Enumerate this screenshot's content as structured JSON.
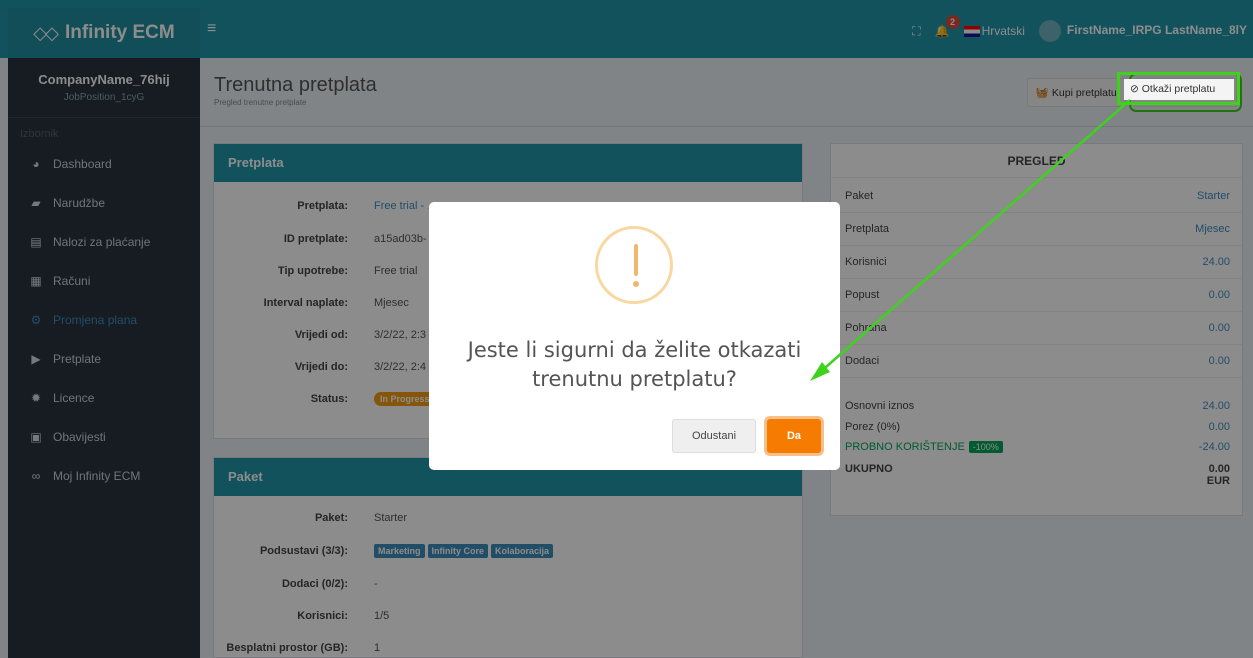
{
  "topbar": {
    "brand": "Infinity ECM",
    "notif_count": "2",
    "language": "Hrvatski",
    "user_name": "FirstName_IRPG LastName_8lY"
  },
  "sidebar": {
    "company": "CompanyName_76hij",
    "position": "JobPosition_1cyG",
    "menu_header": "Izbornik",
    "items": [
      {
        "label": "Dashboard",
        "icon": "dashboard-icon"
      },
      {
        "label": "Narudžbe",
        "icon": "truck-icon"
      },
      {
        "label": "Nalozi za plaćanje",
        "icon": "document-icon"
      },
      {
        "label": "Računi",
        "icon": "invoice-icon"
      },
      {
        "label": "Promjena plana",
        "icon": "cogs-icon"
      },
      {
        "label": "Pretplate",
        "icon": "play-circle-icon"
      },
      {
        "label": "Licence",
        "icon": "certificate-icon"
      },
      {
        "label": "Obavijesti",
        "icon": "newspaper-icon"
      },
      {
        "label": "Moj Infinity ECM",
        "icon": "infinity-icon"
      }
    ]
  },
  "header": {
    "title": "Trenutna pretplata",
    "subtitle": "Pregled trenutne pretplate",
    "buy_label": "Kupi pretplatu",
    "cancel_label": "Otkaži pretplatu"
  },
  "subscription": {
    "title": "Pretplata",
    "rows": [
      {
        "key": "Pretplata:",
        "value": "Free trial - …  …  …"
      },
      {
        "key": "ID pretplate:",
        "value": "a15ad03b-"
      },
      {
        "key": "Tip upotrebe:",
        "value": "Free trial"
      },
      {
        "key": "Interval naplate:",
        "value": "Mjesec"
      },
      {
        "key": "Vrijedi od:",
        "value": "3/2/22, 2:3"
      },
      {
        "key": "Vrijedi do:",
        "value": "3/2/22, 2:4"
      },
      {
        "key": "Status:",
        "value": "In Progress"
      }
    ]
  },
  "package": {
    "title": "Paket",
    "rows": [
      {
        "key": "Paket:",
        "value": "Starter"
      },
      {
        "key": "Podsustavi (3/3):",
        "value": ""
      },
      {
        "key": "Dodaci (0/2):",
        "value": "-"
      },
      {
        "key": "Korisnici:",
        "value": "1/5"
      },
      {
        "key": "Besplatni prostor (GB):",
        "value": "1"
      }
    ],
    "subsystems": [
      "Marketing",
      "Infinity Core",
      "Kolaboracija"
    ]
  },
  "overview": {
    "title": "PREGLED",
    "rows": [
      {
        "label": "Paket",
        "value": "Starter"
      },
      {
        "label": "Pretplata",
        "value": "Mjesec"
      },
      {
        "label": "Korisnici",
        "value": "24.00"
      },
      {
        "label": "Popust",
        "value": "0.00"
      },
      {
        "label": "Pohrana",
        "value": "0.00"
      },
      {
        "label": "Dodaci",
        "value": "0.00"
      }
    ],
    "base_label": "Osnovni iznos",
    "base_value": "24.00",
    "tax_label": "Porez (0%)",
    "tax_value": "0.00",
    "trial_label": "PROBNO KORIŠTENJE",
    "trial_badge": "-100%",
    "trial_value": "-24.00",
    "total_label": "UKUPNO",
    "total_value": "0.00",
    "currency": "EUR"
  },
  "modal": {
    "line1": "Jeste li sigurni da želite otkazati",
    "line2": "trenutnu pretplatu?",
    "cancel": "Odustani",
    "confirm": "Da"
  },
  "colors": {
    "primary": "#2196aa",
    "sidebar": "#2a3440",
    "link": "#3c8dbc",
    "confirm": "#f57c00",
    "highlight": "#3ed21d"
  }
}
